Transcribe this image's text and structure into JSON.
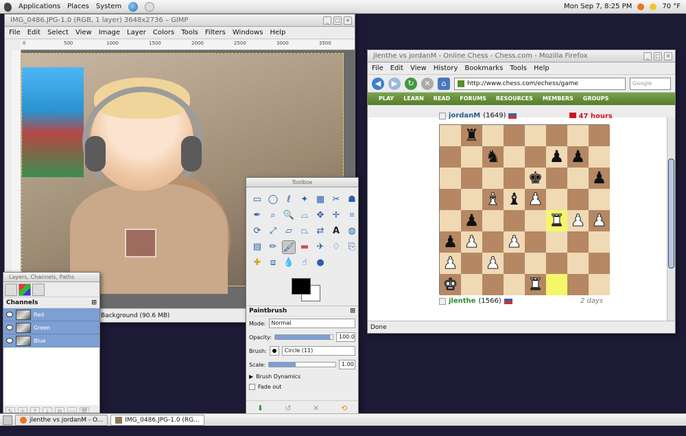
{
  "top_panel": {
    "menus": [
      "Applications",
      "Places",
      "System"
    ],
    "clock": "Mon Sep  7,  8:25 PM",
    "weather": "70 °F"
  },
  "gimp_image": {
    "title": "IMG_0486.JPG-1.0 (RGB, 1 layer) 3648x2736 – GIMP",
    "menus": [
      "File",
      "Edit",
      "Select",
      "View",
      "Image",
      "Layer",
      "Colors",
      "Tools",
      "Filters",
      "Windows",
      "Help"
    ],
    "ruler_labels": [
      "0",
      "500",
      "1000",
      "1500",
      "2000",
      "2500",
      "3000",
      "3500"
    ],
    "status": "Background (90.6 MB)"
  },
  "firefox": {
    "title": "jlenthe vs jordanM - Online Chess - Chess.com - Mozilla Firefox",
    "menus": [
      "File",
      "Edit",
      "View",
      "History",
      "Bookmarks",
      "Tools",
      "Help"
    ],
    "url": "http://www.chess.com/echess/game",
    "search_placeholder": "Google",
    "site_nav": [
      "PLAY",
      "LEARN",
      "READ",
      "FORUMS",
      "RESOURCES",
      "MEMBERS",
      "GROUPS"
    ],
    "top_player": {
      "name": "jordanM",
      "rating": "(1649)",
      "time": "47 hours",
      "time_color": "#d0141c"
    },
    "bottom_player": {
      "name": "jlenthe",
      "rating": "(1566)",
      "time": "2 days"
    },
    "status": "Done",
    "board": [
      [
        "",
        "r",
        "",
        "",
        "",
        "",
        "",
        ""
      ],
      [
        "",
        "",
        "n",
        "",
        "",
        "p",
        "p",
        ""
      ],
      [
        "",
        "",
        "",
        "",
        "k",
        "",
        "",
        "p"
      ],
      [
        "",
        "",
        "B",
        "b",
        "P",
        "",
        "",
        ""
      ],
      [
        "",
        "p",
        "",
        "",
        "",
        "R",
        "P",
        "P"
      ],
      [
        "p",
        "P",
        "",
        "P",
        "",
        "",
        "",
        ""
      ],
      [
        "P",
        "",
        "P",
        "",
        "",
        "",
        "",
        ""
      ],
      [
        "K",
        "",
        "",
        "",
        "R",
        "",
        "",
        ""
      ]
    ],
    "highlights": [
      [
        4,
        5
      ],
      [
        7,
        5
      ]
    ]
  },
  "layers_dialog": {
    "title": "Layers, Channels, Paths",
    "section": "Channels",
    "channels": [
      "Red",
      "Green",
      "Blue"
    ]
  },
  "toolbox": {
    "title": "Toolbox",
    "options_title": "Paintbrush",
    "mode_label": "Mode:",
    "mode_value": "Normal",
    "opacity_label": "Opacity:",
    "opacity_value": "100.0",
    "brush_label": "Brush:",
    "brush_value": "Circle (11)",
    "scale_label": "Scale:",
    "scale_value": "1.00",
    "brush_dynamics": "Brush Dynamics",
    "fade_out": "Fade out"
  },
  "taskbar": {
    "tasks": [
      "jlenthe vs jordanM - O...",
      "IMG_0486.JPG-1.0 (RG..."
    ]
  }
}
